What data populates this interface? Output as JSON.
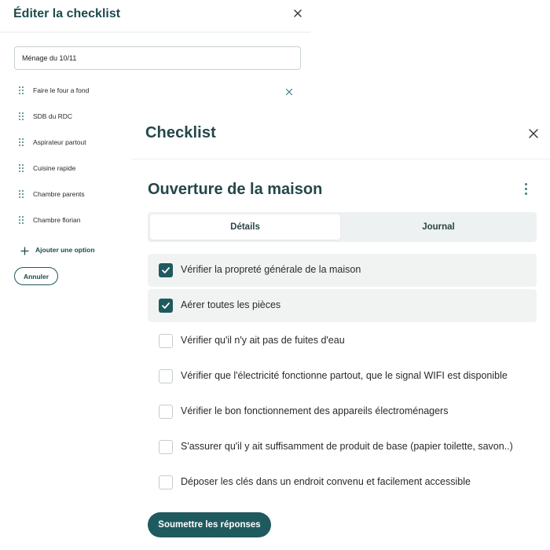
{
  "edit_panel": {
    "title": "Éditer la checklist",
    "name_value": "Ménage du 10/11",
    "options": [
      {
        "label": "Faire le four a fond"
      },
      {
        "label": "SDB du RDC"
      },
      {
        "label": "Aspirateur partout"
      },
      {
        "label": "Cuisine rapide"
      },
      {
        "label": "Chambre parents"
      },
      {
        "label": "Chambre florian"
      }
    ],
    "add_option_label": "Ajouter une option",
    "cancel_label": "Annuler"
  },
  "checklist": {
    "title": "Checklist",
    "form_title": "Ouverture de la maison",
    "tabs": [
      {
        "label": "Détails",
        "active": true
      },
      {
        "label": "Journal",
        "active": false
      }
    ],
    "items": [
      {
        "label": "Vérifier la propreté générale de la maison",
        "checked": true
      },
      {
        "label": "Aérer toutes les pièces",
        "checked": true
      },
      {
        "label": "Vérifier qu'il n'y ait pas de fuites d'eau",
        "checked": false
      },
      {
        "label": "Vérifier que l'électricité fonctionne partout, que le signal WIFI est disponible",
        "checked": false
      },
      {
        "label": "Vérifier le bon fonctionnement des appareils électroménagers",
        "checked": false
      },
      {
        "label": "S'assurer qu'il y ait suffisamment de produit de base (papier toilette, savon..)",
        "checked": false
      },
      {
        "label": "Déposer les clés dans un endroit convenu et facilement accessible",
        "checked": false
      }
    ],
    "submit_label": "Soumettre les réponses"
  },
  "colors": {
    "accent": "#1f5a5e",
    "title": "#24474a",
    "checked_row_bg": "#f1f3f3",
    "tabs_bg": "#eef1f1"
  },
  "icons": {
    "close": "close-icon",
    "drag": "drag-handle-icon",
    "remove": "remove-option-icon",
    "add": "plus-icon",
    "menu": "more-vertical-icon",
    "check": "checkmark-icon"
  }
}
